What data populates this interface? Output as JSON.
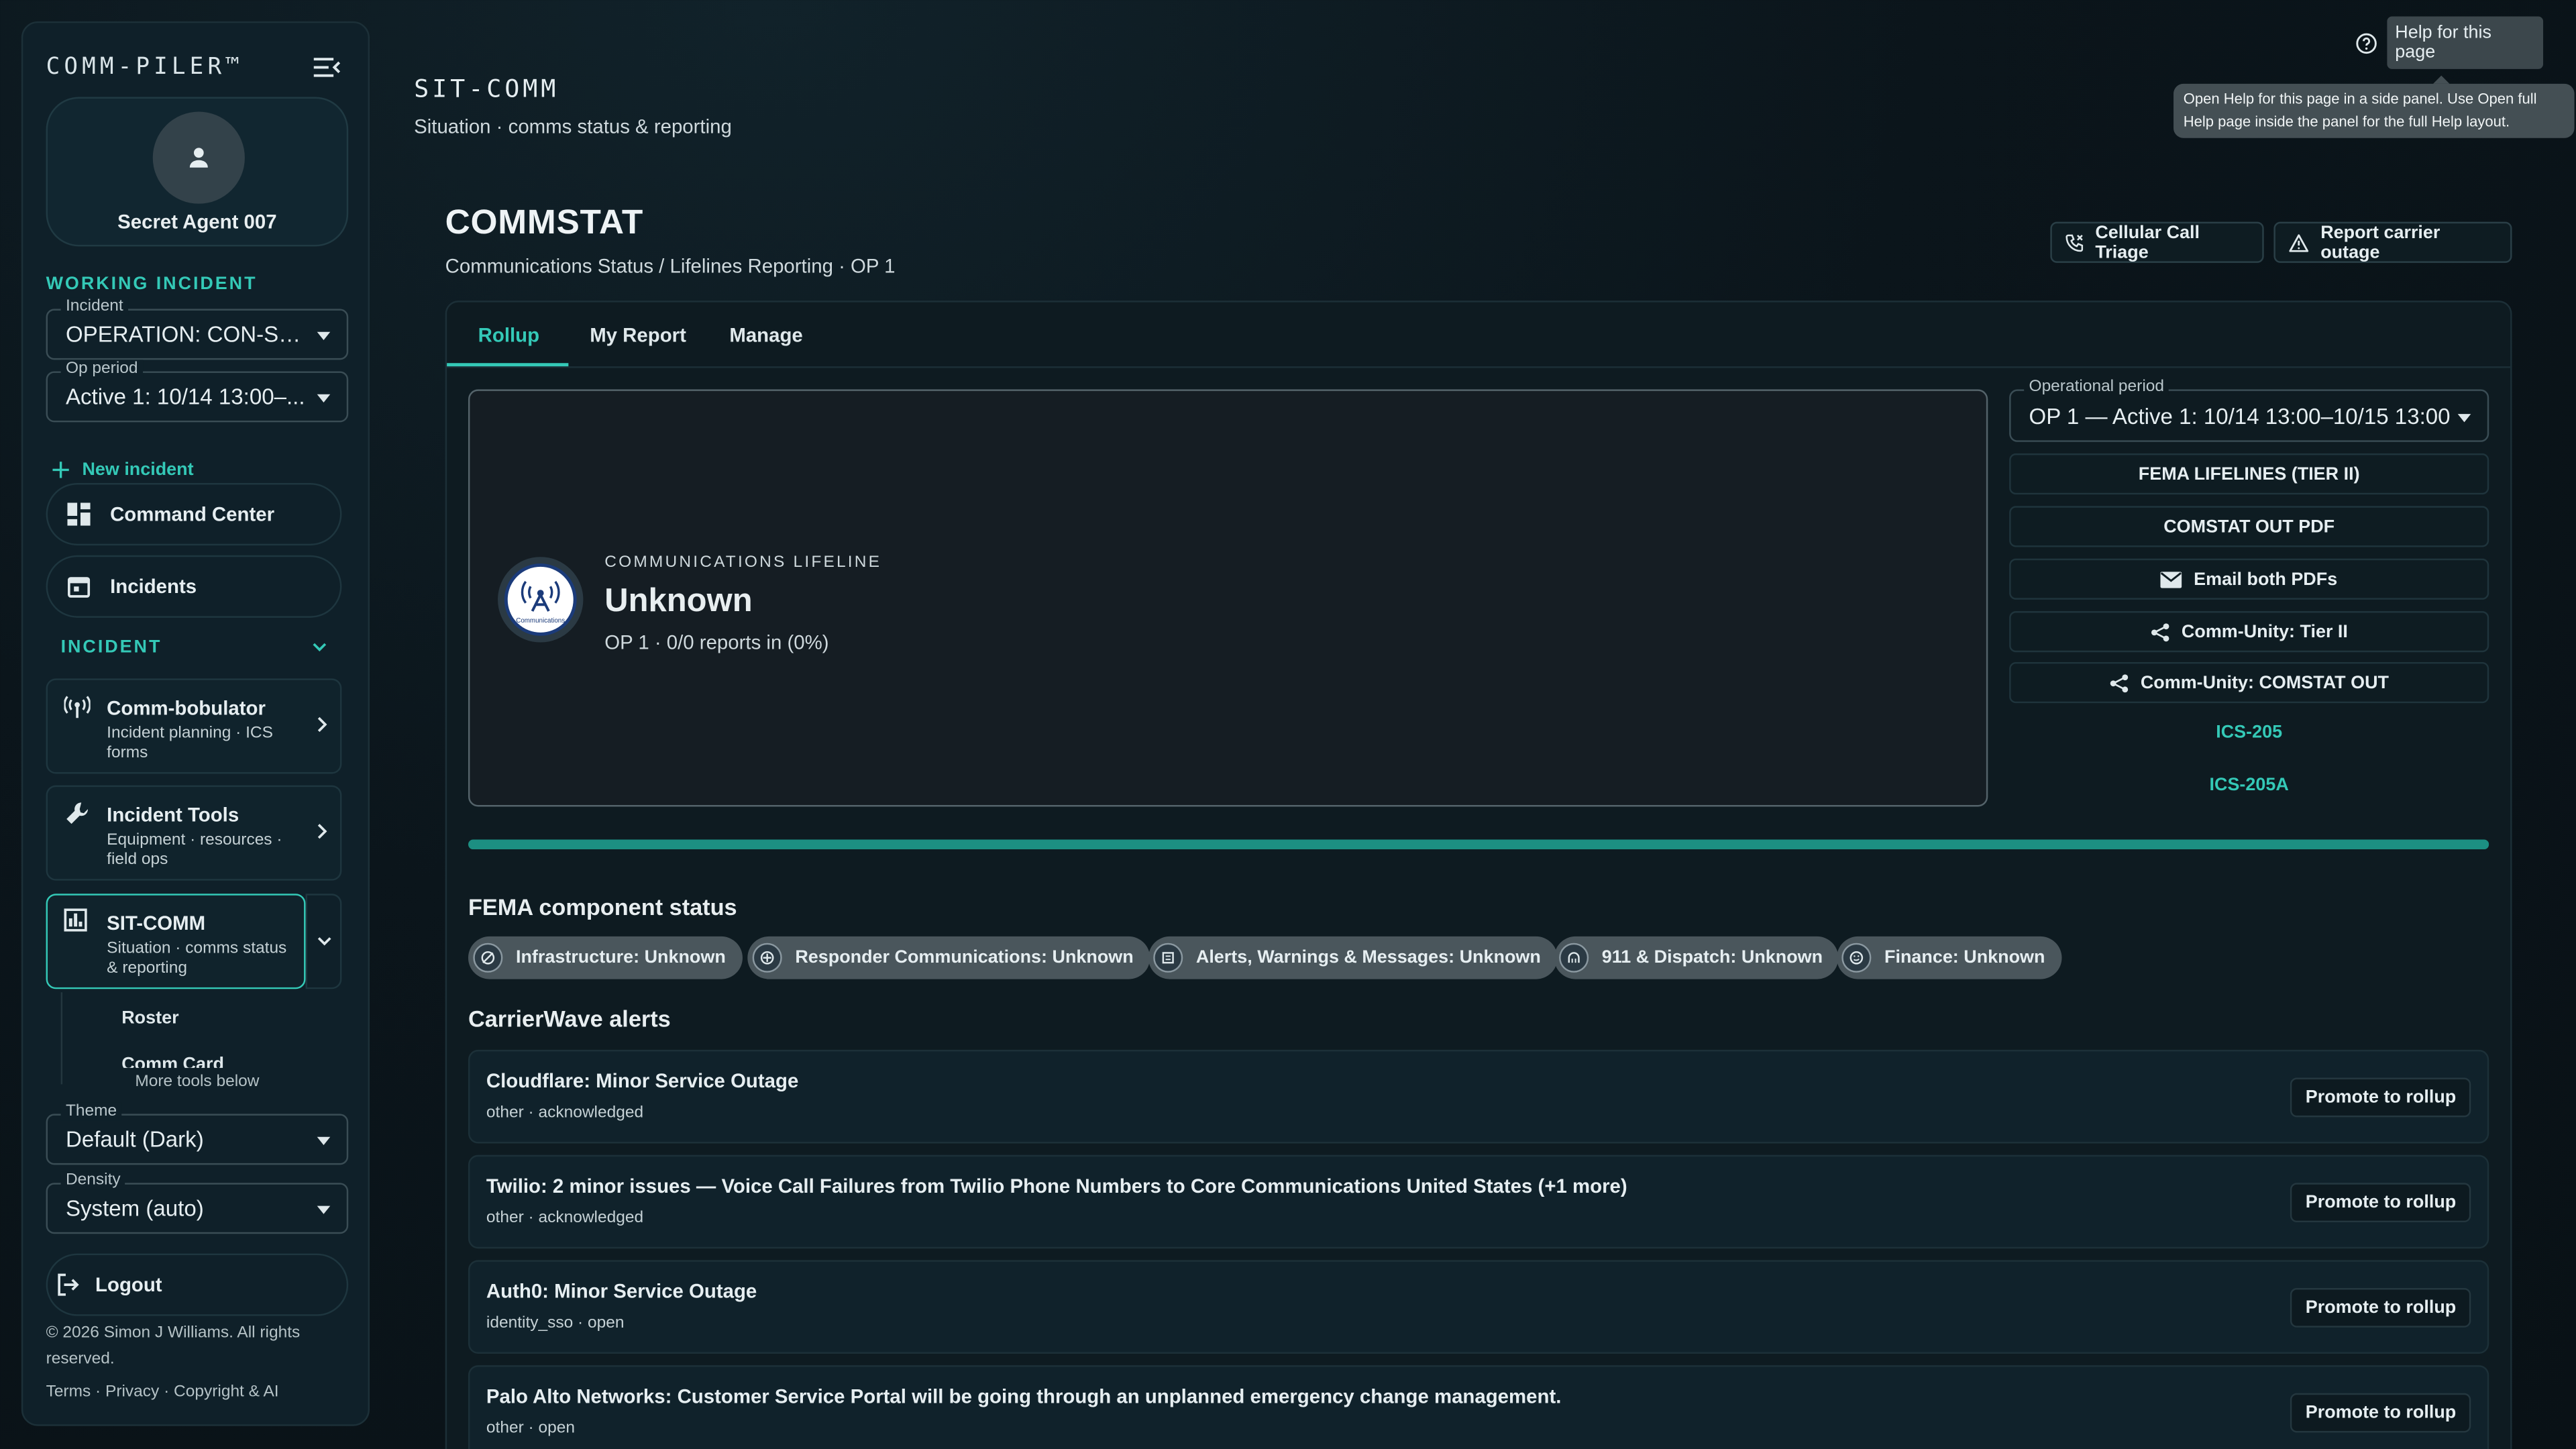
{
  "app": {
    "brand": "COMM-PILER™"
  },
  "user": {
    "name": "Secret Agent 007"
  },
  "sidebar": {
    "working_incident_label": "WORKING INCIDENT",
    "incident_select": {
      "label": "Incident",
      "value": "OPERATION: CON-SP..."
    },
    "op_select": {
      "label": "Op period",
      "value": "Active 1: 10/14 13:00–..."
    },
    "new_incident": "New incident",
    "command_center": "Command Center",
    "incidents": "Incidents",
    "incident_section": "INCIDENT",
    "cards": [
      {
        "title": "Comm-bobulator",
        "desc": "Incident planning · ICS forms"
      },
      {
        "title": "Incident Tools",
        "desc": "Equipment · resources · field ops"
      },
      {
        "title": "SIT-COMM",
        "desc": "Situation · comms status & reporting"
      }
    ],
    "sub_items": [
      "Roster",
      "Comm Card"
    ],
    "more_tools": "More tools below",
    "theme": {
      "label": "Theme",
      "value": "Default (Dark)"
    },
    "density": {
      "label": "Density",
      "value": "System (auto)"
    },
    "logout": "Logout",
    "copyright": "© 2026 Simon J Williams. All rights reserved.",
    "footer_links": "Terms · Privacy · Copyright & AI"
  },
  "header": {
    "title": "SIT-COMM",
    "subtitle": "Situation · comms status & reporting",
    "help_label": "Help for this page",
    "help_tooltip": "Open Help for this page in a side panel. Use Open full Help page inside the panel for the full Help layout."
  },
  "main": {
    "title": "COMMSTAT",
    "subtitle": "Communications Status / Lifelines Reporting · OP 1",
    "actions": [
      "Cellular Call Triage",
      "Report carrier outage"
    ],
    "tabs": [
      "Rollup",
      "My Report",
      "Manage"
    ],
    "lifeline": {
      "overline": "COMMUNICATIONS LIFELINE",
      "status": "Unknown",
      "meta": "OP 1 · 0/0 reports in (0%)",
      "icon_text": "Communications"
    },
    "op_period": {
      "label": "Operational period",
      "value": "OP 1 — Active 1: 10/14 13:00–10/15 13:00"
    },
    "side_buttons": [
      "FEMA LIFELINES (TIER II)",
      "COMSTAT OUT PDF",
      "Email both PDFs",
      "Comm-Unity: Tier II",
      "Comm-Unity: COMSTAT OUT"
    ],
    "side_links": [
      "ICS-205",
      "ICS-205A"
    ],
    "progress": 1.0,
    "fema_heading": "FEMA component status",
    "components": [
      "Infrastructure: Unknown",
      "Responder Communications: Unknown",
      "Alerts, Warnings & Messages: Unknown",
      "911 & Dispatch: Unknown",
      "Finance: Unknown"
    ],
    "alerts_heading": "CarrierWave alerts",
    "alerts": [
      {
        "title": "Cloudflare: Minor Service Outage",
        "meta": "other · acknowledged",
        "action": "Promote to rollup"
      },
      {
        "title": "Twilio: 2 minor issues — Voice Call Failures from Twilio Phone Numbers to Core Communications United States (+1 more)",
        "meta": "other · acknowledged",
        "action": "Promote to rollup"
      },
      {
        "title": "Auth0: Minor Service Outage",
        "meta": "identity_sso · open",
        "action": "Promote to rollup"
      },
      {
        "title": "Palo Alto Networks: Customer Service Portal will be going through an unplanned emergency change management.",
        "meta": "other · open",
        "action": "Promote to rollup"
      }
    ]
  },
  "colors": {
    "accent": "#34c9b7",
    "background": "#0b151b",
    "progress": "#1c8f82"
  }
}
